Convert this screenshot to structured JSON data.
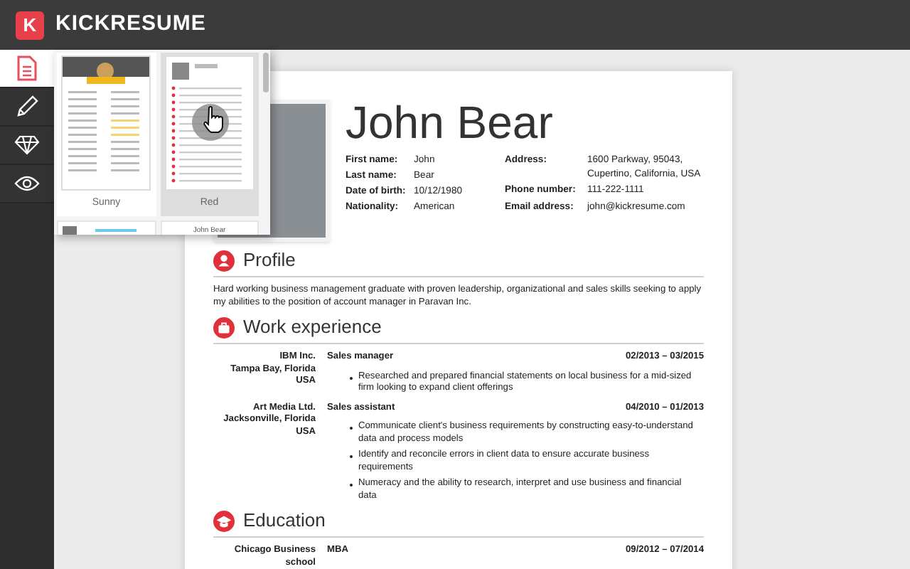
{
  "app": {
    "logo_letter": "K",
    "name": "KICKRESUME"
  },
  "sidebar": {
    "items": [
      {
        "selected": true
      },
      {
        "selected": false
      },
      {
        "selected": false
      },
      {
        "selected": false
      }
    ]
  },
  "template_picker": {
    "templates": [
      {
        "label": "Sunny",
        "selected": false
      },
      {
        "label": "Red",
        "selected": true
      }
    ],
    "more_templates": [
      {
        "title": "John Bear"
      }
    ]
  },
  "resume": {
    "name": "John Bear",
    "personal": [
      {
        "label": "First name:",
        "value": "John"
      },
      {
        "label": "Last name:",
        "value": "Bear"
      },
      {
        "label": "Date of birth:",
        "value": "10/12/1980"
      },
      {
        "label": "Nationality:",
        "value": "American"
      }
    ],
    "contact": [
      {
        "label": "Address:",
        "value": "1600 Parkway, 95043,\nCupertino, California, USA"
      },
      {
        "label": "Phone number:",
        "value": "111-222-1111"
      },
      {
        "label": "Email address:",
        "value": "john@kickresume.com"
      }
    ],
    "sections": [
      {
        "title": "Profile",
        "text": "Hard working business management graduate with proven leadership, organizational and sales skills seeking to apply my abilities to the position of account manager in Paravan Inc."
      },
      {
        "title": "Work experience",
        "entries": [
          {
            "place": "IBM Inc.\nTampa Bay, Florida\nUSA",
            "role": "Sales manager",
            "dates": "02/2013 – 03/2015",
            "bullets": [
              "Researched and prepared financial statements on local business for a mid-sized firm looking to expand client offerings"
            ]
          },
          {
            "place": "Art Media Ltd.\nJacksonville, Florida\nUSA",
            "role": "Sales assistant",
            "dates": "04/2010 – 01/2013",
            "bullets": [
              "Communicate client's business requirements by constructing easy-to-understand data and process models",
              "Identify and reconcile errors in client data to ensure accurate business requirements",
              "Numeracy and the ability to research, interpret and use business and financial data"
            ]
          }
        ]
      },
      {
        "title": "Education",
        "entries": [
          {
            "place": "Chicago Business\nschool",
            "role": "MBA",
            "dates": "09/2012 – 07/2014"
          }
        ]
      }
    ]
  }
}
